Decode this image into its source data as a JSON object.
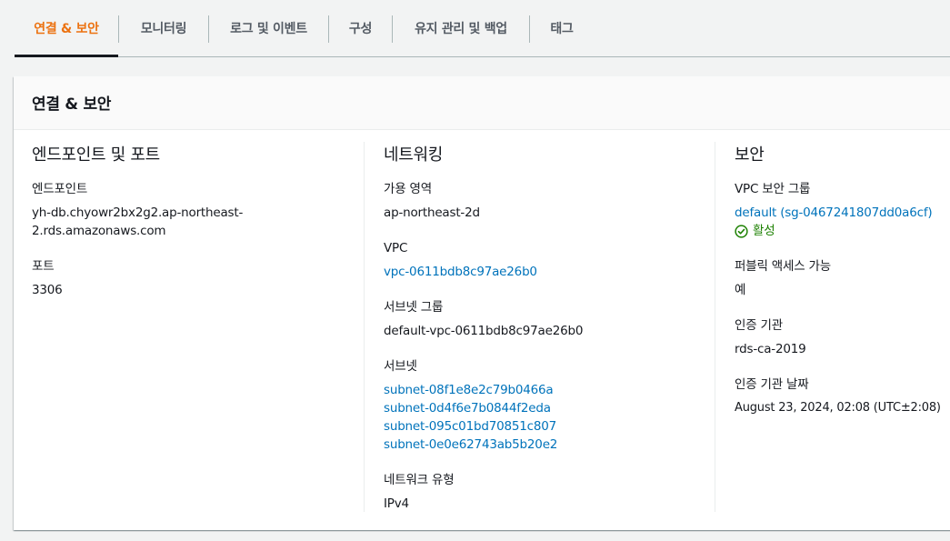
{
  "tabs": [
    {
      "label": "연결 & 보안",
      "active": true
    },
    {
      "label": "모니터링"
    },
    {
      "label": "로그 및 이벤트"
    },
    {
      "label": "구성"
    },
    {
      "label": "유지 관리 및 백업"
    },
    {
      "label": "태그"
    }
  ],
  "panel": {
    "title": "연결 & 보안"
  },
  "endpoint_section": {
    "title": "엔드포인트 및 포트",
    "endpoint_label": "엔드포인트",
    "endpoint_line1": "yh-db.chyowr2bx2g2.ap-northeast-",
    "endpoint_line2": "2.rds.amazonaws.com",
    "port_label": "포트",
    "port_value": "3306"
  },
  "network_section": {
    "title": "네트워킹",
    "az_label": "가용 영역",
    "az_value": "ap-northeast-2d",
    "vpc_label": "VPC",
    "vpc_value": "vpc-0611bdb8c97ae26b0",
    "subnet_group_label": "서브넷 그룹",
    "subnet_group_value": "default-vpc-0611bdb8c97ae26b0",
    "subnets_label": "서브넷",
    "subnets": [
      "subnet-08f1e8e2c79b0466a",
      "subnet-0d4f6e7b0844f2eda",
      "subnet-095c01bd70851c807",
      "subnet-0e0e62743ab5b20e2"
    ],
    "network_type_label": "네트워크 유형",
    "network_type_value": "IPv4"
  },
  "security_section": {
    "title": "보안",
    "sg_label": "VPC 보안 그룹",
    "sg_value": "default (sg-0467241807dd0a6cf)",
    "sg_status": "활성",
    "public_label": "퍼블릭 액세스 가능",
    "public_value": "예",
    "ca_label": "인증 기관",
    "ca_value": "rds-ca-2019",
    "ca_date_label": "인증 기관 날짜",
    "ca_date_value": "August 23, 2024, 02:08 (UTC±2:08)"
  },
  "colors": {
    "accent": "#ec7211",
    "link": "#0073bb",
    "success": "#1d8102"
  }
}
